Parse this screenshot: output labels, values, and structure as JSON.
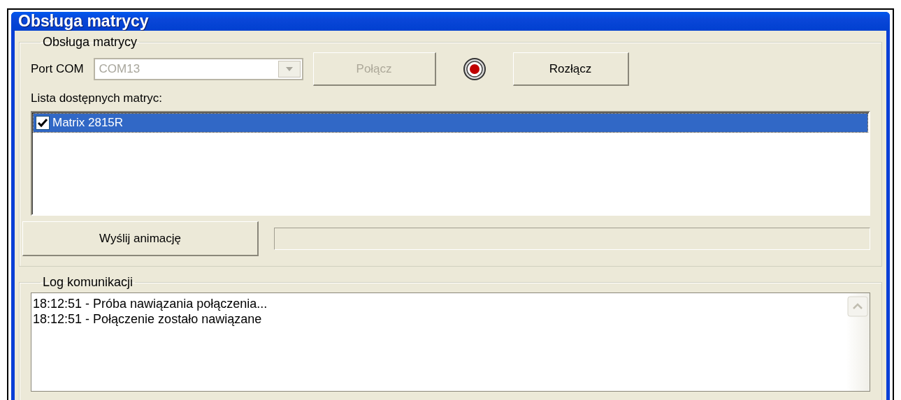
{
  "window": {
    "title": "Obsługa matrycy"
  },
  "matrix_group": {
    "title": "Obsługa matrycy",
    "port_label": "Port COM",
    "port": {
      "value": "COM13",
      "disabled": true
    },
    "connect_button": {
      "label": "Połącz",
      "disabled": true
    },
    "status_led": {
      "color": "#c00000"
    },
    "disconnect_button": {
      "label": "Rozłącz",
      "disabled": false
    },
    "list_label": "Lista dostępnych matryc:",
    "matrices": [
      {
        "name": "Matrix 2815R",
        "checked": true,
        "selected": true
      }
    ],
    "send_button": {
      "label": "Wyślij animację"
    },
    "progress": {
      "level": 0
    }
  },
  "log_group": {
    "title": "Log komunikacji",
    "lines": [
      "18:12:51 - Próba nawiązania połączenia...",
      "18:12:51 - Połączenie zostało nawiązane"
    ]
  }
}
